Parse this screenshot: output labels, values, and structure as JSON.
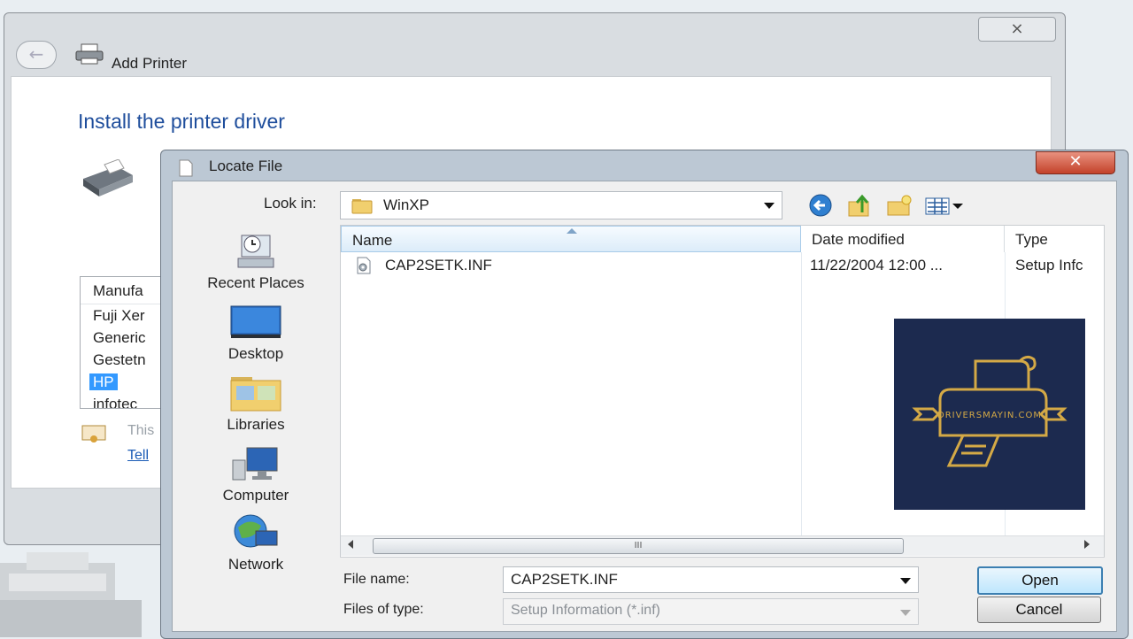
{
  "background_window": {
    "title": "Add Printer",
    "close_glyph": "⨯",
    "back_glyph": "←",
    "heading": "Install the printer driver",
    "manufacturer_list": {
      "header": "Manufa",
      "items": [
        "Fuji Xer",
        "Generic",
        "Gestetn",
        "HP",
        "infotec"
      ],
      "selected": "HP"
    },
    "signed_text": "This",
    "link_text": "Tell"
  },
  "dialog": {
    "title": "Locate File",
    "close_glyph": "✕",
    "look_in_label": "Look in:",
    "look_in_value": "WinXP",
    "toolbar_icons": [
      "back-icon",
      "up-folder-icon",
      "new-folder-icon",
      "views-menu-icon"
    ],
    "places": [
      {
        "label": "Recent Places",
        "icon": "recent-places-icon"
      },
      {
        "label": "Desktop",
        "icon": "desktop-icon"
      },
      {
        "label": "Libraries",
        "icon": "libraries-icon"
      },
      {
        "label": "Computer",
        "icon": "computer-icon"
      },
      {
        "label": "Network",
        "icon": "network-icon"
      }
    ],
    "columns": [
      "Name",
      "Date modified",
      "Type"
    ],
    "files": [
      {
        "name": "CAP2SETK.INF",
        "date_modified": "11/22/2004 12:00 ...",
        "type": "Setup Infc"
      }
    ],
    "scroll_grip": "III",
    "file_name_label": "File name:",
    "file_name_value": "CAP2SETK.INF",
    "file_type_label": "Files of type:",
    "file_type_value": "Setup Information (*.inf)",
    "open_label": "Open",
    "cancel_label": "Cancel"
  },
  "watermark": {
    "text": "DRIVERSMAYIN.COM",
    "background_color": "#1c2a4f",
    "accent_color": "#d4a946"
  }
}
